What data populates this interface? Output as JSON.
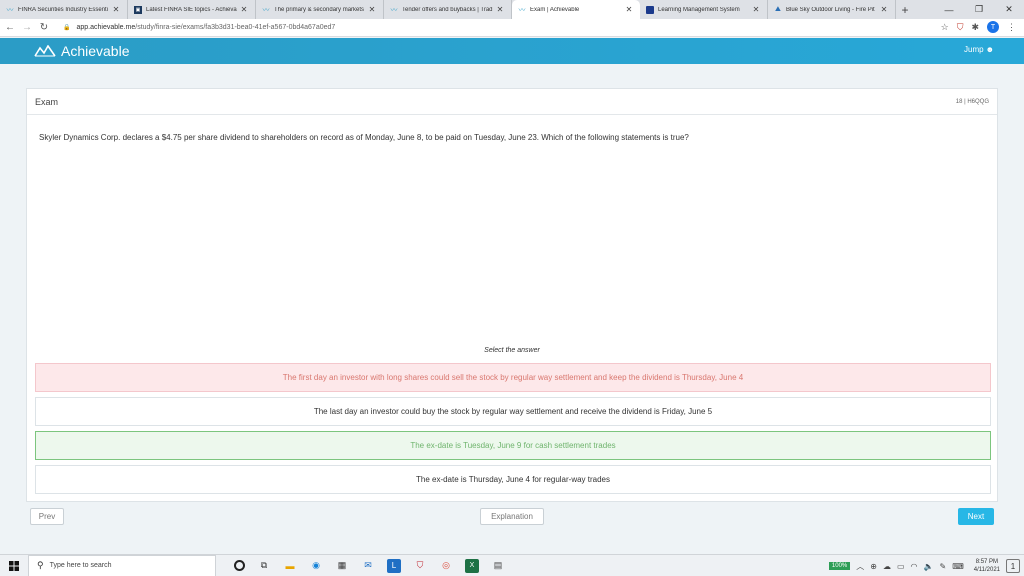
{
  "browser": {
    "tabs": [
      {
        "title": "FINRA Securities Industry Essenti",
        "favicon": "achievable-icon",
        "active": false
      },
      {
        "title": "Latest FINRA SIE topics - Achieva",
        "favicon": "forum-icon",
        "active": false
      },
      {
        "title": "The primary & secondary markets",
        "favicon": "achievable-icon",
        "active": false
      },
      {
        "title": "Tender offers and buybacks | Trad",
        "favicon": "achievable-icon",
        "active": false
      },
      {
        "title": "Exam | Achievable",
        "favicon": "achievable-icon",
        "active": true
      },
      {
        "title": "Learning Management System",
        "favicon": "lms-icon",
        "active": false
      },
      {
        "title": "Blue Sky Outdoor Living - Fire Pit",
        "favicon": "bluesky-icon",
        "active": false
      }
    ],
    "new_tab": "+",
    "url_domain": "app.achievable.me",
    "url_path": "/study/finra-sie/exams/fa3b3d31-bea0-41ef-a567-0bd4a67a0ed7",
    "profile_initial": "T"
  },
  "app": {
    "brand": "Achievable",
    "jump_label": "Jump"
  },
  "exam": {
    "title": "Exam",
    "question_id": "18 | H6QQG",
    "question": "Skyler Dynamics Corp. declares a $4.75 per share dividend to shareholders on record as of Monday, June 8, to be paid on Tuesday, June 23. Which of the following statements is true?",
    "select_label": "Select the answer",
    "answers": [
      {
        "text": "The first day an investor with long shares could sell the stock by regular way settlement and keep the dividend is Thursday, June 4",
        "state": "wrong"
      },
      {
        "text": "The last day an investor could buy the stock by regular way settlement and receive the dividend is Friday, June 5",
        "state": "neutral"
      },
      {
        "text": "The ex-date is Tuesday, June 9 for cash settlement trades",
        "state": "correct"
      },
      {
        "text": "The ex-date is Thursday, June 4 for regular-way trades",
        "state": "neutral"
      }
    ],
    "prev_label": "Prev",
    "explanation_label": "Explanation",
    "next_label": "Next"
  },
  "taskbar": {
    "search_placeholder": "Type here to search",
    "battery": "100%",
    "time": "8:57 PM",
    "date": "4/11/2021",
    "notification_count": "1"
  },
  "colors": {
    "brand": "#28a8d8",
    "wrong_bg": "#fde8ea",
    "correct_border": "#7cc57e",
    "next_button": "#27b7e6"
  }
}
